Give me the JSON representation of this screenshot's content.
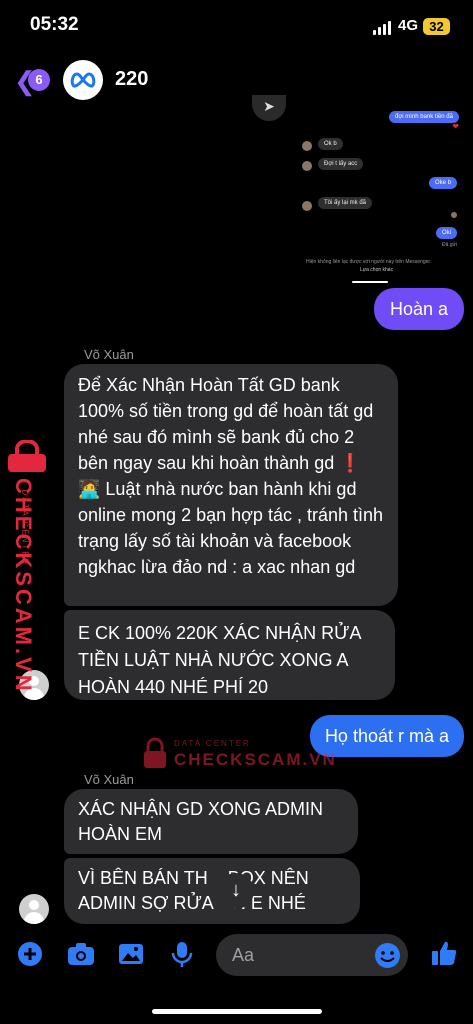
{
  "status_bar": {
    "time": "05:32",
    "network": "4G",
    "battery": "32"
  },
  "header": {
    "back_count": "6",
    "title": "220"
  },
  "embedded_screenshot": {
    "messages": [
      {
        "side": "out",
        "text": "đợi mình bank tiền đã"
      },
      {
        "side": "in",
        "text": "Ok b"
      },
      {
        "side": "in",
        "text": "Đợi t lấy acc"
      },
      {
        "side": "out",
        "text": "Oke b"
      },
      {
        "side": "in",
        "text": "Tôi ấy lại mk đã"
      },
      {
        "side": "out",
        "text": "Oki"
      }
    ],
    "seen_note": "Đã gửi",
    "footer_note": "Hiện không liên lạc được với người này trên Messenger.",
    "footer_action": "Lựa chọn khác"
  },
  "messages": [
    {
      "sender": "",
      "side": "out",
      "text": "Hoàn a"
    },
    {
      "sender": "Võ Xuân",
      "side": "in",
      "text": "Để Xác Nhận Hoàn Tất GD bank 100% số tiền trong gd để hoàn tất gd nhé sau đó mình sẽ bank đủ cho 2 bên  ngay sau khi hoàn thành gd  ❗️ 🧑‍💻 Luật nhà nước ban hành khi gd online mong 2 bạn hợp tác , tránh tình trạng lấy số tài khoản và facebook ngkhac lừa đảo nd : a xac nhan gd"
    },
    {
      "sender": "",
      "side": "in",
      "text": "E CK 100% 220K XÁC NHẬN RỬA TIỀN LUẬT NHÀ NƯỚC XONG A HOÀN 440 NHÉ PHÍ 20"
    },
    {
      "sender": "",
      "side": "out",
      "text": "Họ thoát r mà a"
    },
    {
      "sender": "Võ Xuân",
      "side": "in",
      "text": "XÁC NHẬN GD XONG ADMIN HOÀN EM"
    },
    {
      "sender": "",
      "side": "in",
      "text": "VÌ BÊN BÁN TH    BOX NÊN ADMIN SỢ RỬA    N E NHÉ"
    }
  ],
  "watermark": {
    "data_center": "DATA CENTER",
    "brand": "CHECKSCAM.VN"
  },
  "composer": {
    "placeholder": "Aa"
  },
  "colors": {
    "accent": "#6f4cf5",
    "outgoing_blue": "#2c6ff0",
    "incoming": "#2d2d2f",
    "icon_blue": "#2f7cf6"
  }
}
